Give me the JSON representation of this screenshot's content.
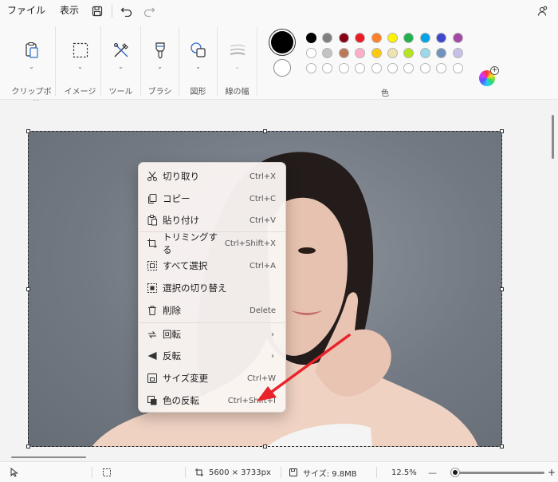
{
  "menubar": {
    "file": "ファイル",
    "view": "表示",
    "save_icon": "save-icon",
    "undo_icon": "undo-icon",
    "redo_icon": "redo-icon",
    "settings_icon": "share-settings-icon"
  },
  "ribbon": {
    "groups": [
      {
        "label": "クリップボード",
        "icon": "clipboard-icon"
      },
      {
        "label": "イメージ",
        "icon": "selection-icon"
      },
      {
        "label": "ツール",
        "icon": "tools-icon"
      },
      {
        "label": "ブラシ",
        "icon": "brush-icon"
      },
      {
        "label": "図形",
        "icon": "shapes-icon"
      },
      {
        "label": "線の幅",
        "icon": "line-width-icon"
      }
    ],
    "colors_label": "色",
    "primary_color": "#000000",
    "secondary_color": "#ffffff",
    "palette_row1": [
      "#000000",
      "#7f7f7f",
      "#880015",
      "#ed1c24",
      "#ff7f27",
      "#fff200",
      "#22b14c",
      "#00a2e8",
      "#3f48cc",
      "#a349a4"
    ],
    "palette_row2": [
      "#ffffff",
      "#c3c3c3",
      "#b97a57",
      "#ffaec9",
      "#ffc90e",
      "#efe4b0",
      "#b5e61d",
      "#99d9ea",
      "#7092be",
      "#c8bfe7"
    ],
    "palette_row3": [
      "#ffffff",
      "#ffffff",
      "#ffffff",
      "#ffffff",
      "#ffffff",
      "#ffffff",
      "#ffffff",
      "#ffffff",
      "#ffffff",
      "#ffffff"
    ]
  },
  "context_menu": {
    "items": [
      {
        "label": "切り取り",
        "shortcut": "Ctrl+X",
        "icon": "scissors-icon"
      },
      {
        "label": "コピー",
        "shortcut": "Ctrl+C",
        "icon": "copy-icon"
      },
      {
        "label": "貼り付け",
        "shortcut": "Ctrl+V",
        "icon": "paste-icon"
      },
      {
        "label": "トリミングする",
        "shortcut": "Ctrl+Shift+X",
        "icon": "crop-icon"
      },
      {
        "label": "すべて選択",
        "shortcut": "Ctrl+A",
        "icon": "select-all-icon"
      },
      {
        "label": "選択の切り替え",
        "shortcut": "",
        "icon": "invert-selection-icon"
      },
      {
        "label": "削除",
        "shortcut": "Delete",
        "icon": "trash-icon"
      },
      {
        "label": "回転",
        "shortcut": "",
        "icon": "rotate-icon"
      },
      {
        "label": "反転",
        "shortcut": "",
        "icon": "flip-icon"
      },
      {
        "label": "サイズ変更",
        "shortcut": "Ctrl+W",
        "icon": "resize-icon"
      },
      {
        "label": "色の反転",
        "shortcut": "Ctrl+Shift+I",
        "icon": "invert-color-icon"
      }
    ],
    "submenu_arrow": "›"
  },
  "status": {
    "dimensions": "5600 × 3733px",
    "size": "サイズ: 9.8MB",
    "zoom": "12.5%",
    "zoom_minus": "—",
    "zoom_plus": "+",
    "zoom_level": 0.05
  },
  "annotation_arrow_color": "#e8232a"
}
